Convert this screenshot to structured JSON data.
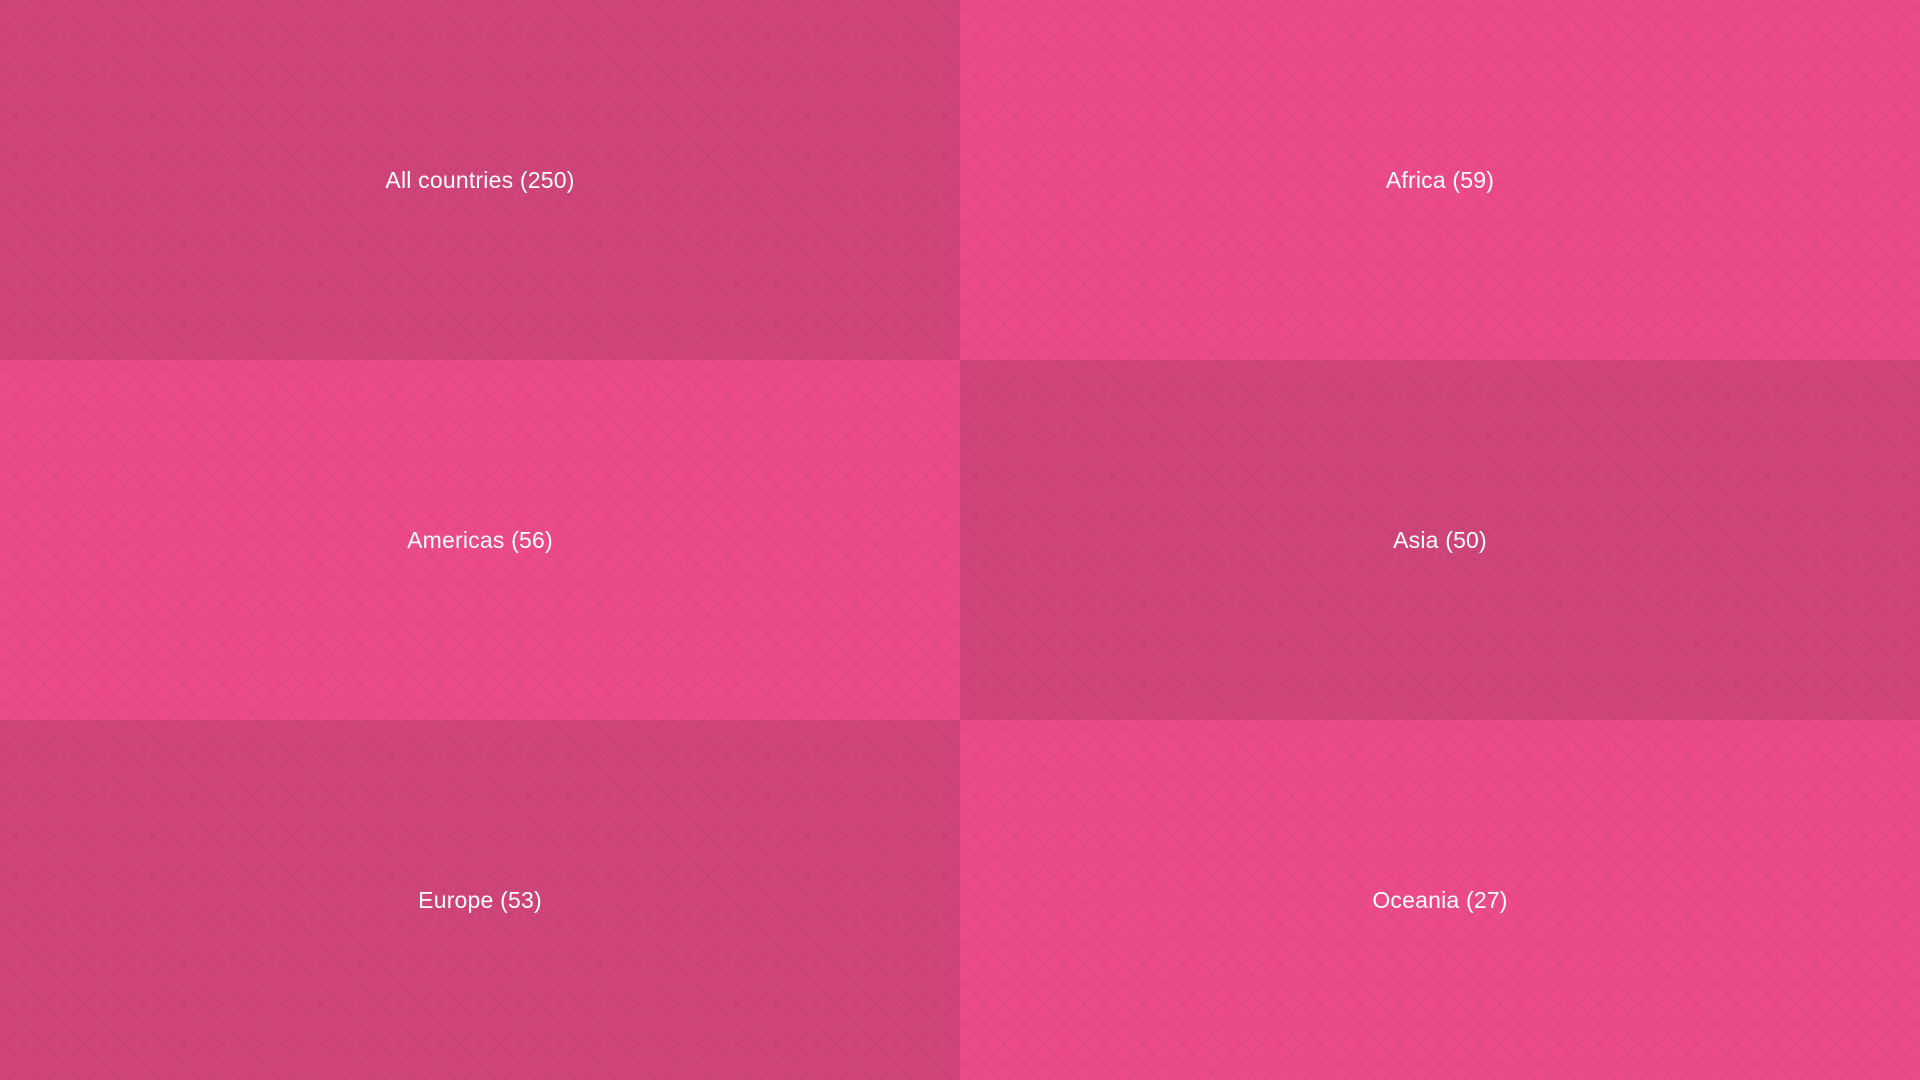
{
  "tiles": [
    {
      "label": "All countries (250)",
      "tone": "dark"
    },
    {
      "label": "Africa (59)",
      "tone": "light"
    },
    {
      "label": "Americas (56)",
      "tone": "light"
    },
    {
      "label": "Asia (50)",
      "tone": "dark"
    },
    {
      "label": "Europe (53)",
      "tone": "dark"
    },
    {
      "label": "Oceania (27)",
      "tone": "light"
    }
  ],
  "colors": {
    "dark": "#cf4479",
    "light": "#ec4a8a",
    "text": "#ffffff"
  }
}
